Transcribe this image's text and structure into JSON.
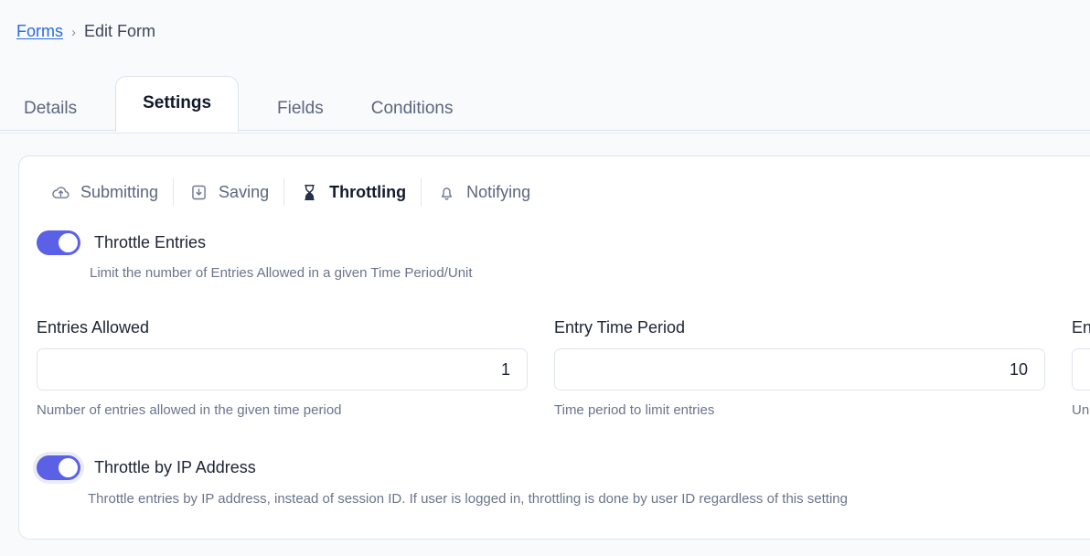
{
  "breadcrumb": {
    "link_label": "Forms",
    "separator": "›",
    "current_label": "Edit Form"
  },
  "tabs": [
    {
      "label": "Details",
      "active": false
    },
    {
      "label": "Settings",
      "active": true
    },
    {
      "label": "Fields",
      "active": false
    },
    {
      "label": "Conditions",
      "active": false
    }
  ],
  "subnav": [
    {
      "label": "Submitting",
      "icon": "cloud-upload-icon",
      "active": false
    },
    {
      "label": "Saving",
      "icon": "save-box-icon",
      "active": false
    },
    {
      "label": "Throttling",
      "icon": "hourglass-icon",
      "active": true
    },
    {
      "label": "Notifying",
      "icon": "bell-icon",
      "active": false
    }
  ],
  "throttle_entries": {
    "label": "Throttle Entries",
    "help": "Limit the number of Entries Allowed in a given Time Period/Unit",
    "enabled": true
  },
  "throttle_ip": {
    "label": "Throttle by IP Address",
    "help": "Throttle entries by IP address, instead of session ID. If user is logged in, throttling is done by user ID regardless of this setting",
    "enabled": true
  },
  "fields": [
    {
      "label": "Entries Allowed",
      "value": "1",
      "placeholder": "",
      "help": "Number of entries allowed in the given time period"
    },
    {
      "label": "Entry Time Period",
      "value": "10",
      "placeholder": "",
      "help": "Time period to limit entries"
    },
    {
      "label": "Entry Time Unit",
      "value": "",
      "placeholder": "",
      "help": "Unit of time for the entry time period"
    }
  ],
  "colors": {
    "accent": "#5b61e6",
    "link": "#2a6ae0",
    "page_background": "#f8fafc",
    "card_background": "#ffffff",
    "border": "#dfe5ee",
    "muted_text": "#6a748c"
  }
}
